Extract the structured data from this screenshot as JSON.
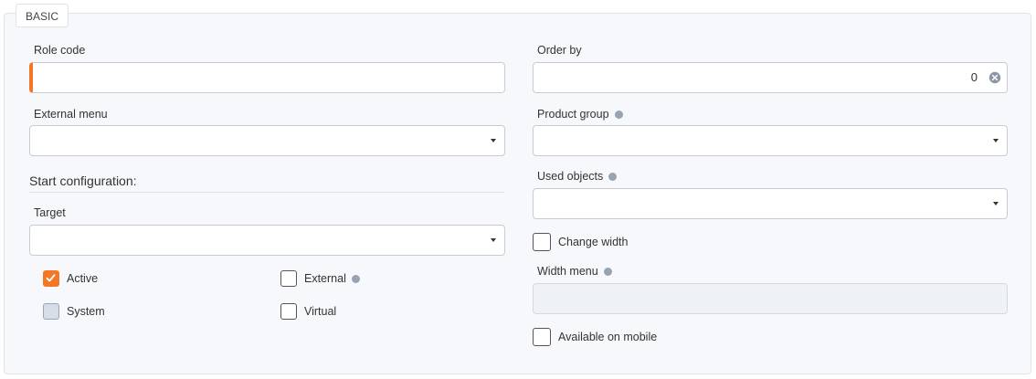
{
  "tab": {
    "label": "BASIC"
  },
  "fields": {
    "role_code": {
      "label": "Role code",
      "value": ""
    },
    "order_by": {
      "label": "Order by",
      "value": "0"
    },
    "external_menu": {
      "label": "External menu",
      "value": ""
    },
    "product_group": {
      "label": "Product group",
      "value": ""
    },
    "used_objects": {
      "label": "Used objects",
      "value": ""
    },
    "target": {
      "label": "Target",
      "value": ""
    },
    "width_menu": {
      "label": "Width menu",
      "value": ""
    }
  },
  "section": {
    "start_configuration": "Start configuration:"
  },
  "checkboxes": {
    "active": {
      "label": "Active",
      "checked": true
    },
    "external": {
      "label": "External",
      "checked": false
    },
    "system": {
      "label": "System",
      "checked": false,
      "disabled": true
    },
    "virtual": {
      "label": "Virtual",
      "checked": false
    },
    "change_width": {
      "label": "Change width",
      "checked": false
    },
    "available_on_mobile": {
      "label": "Available on mobile",
      "checked": false
    }
  },
  "colors": {
    "accent": "#f37826",
    "info_dot": "#97a3b2",
    "border": "#c7ccd4"
  },
  "icons": {
    "clear": "clear-circle-icon",
    "dropdown": "caret-down-icon",
    "info": "info-dot-icon",
    "check": "check-icon"
  }
}
